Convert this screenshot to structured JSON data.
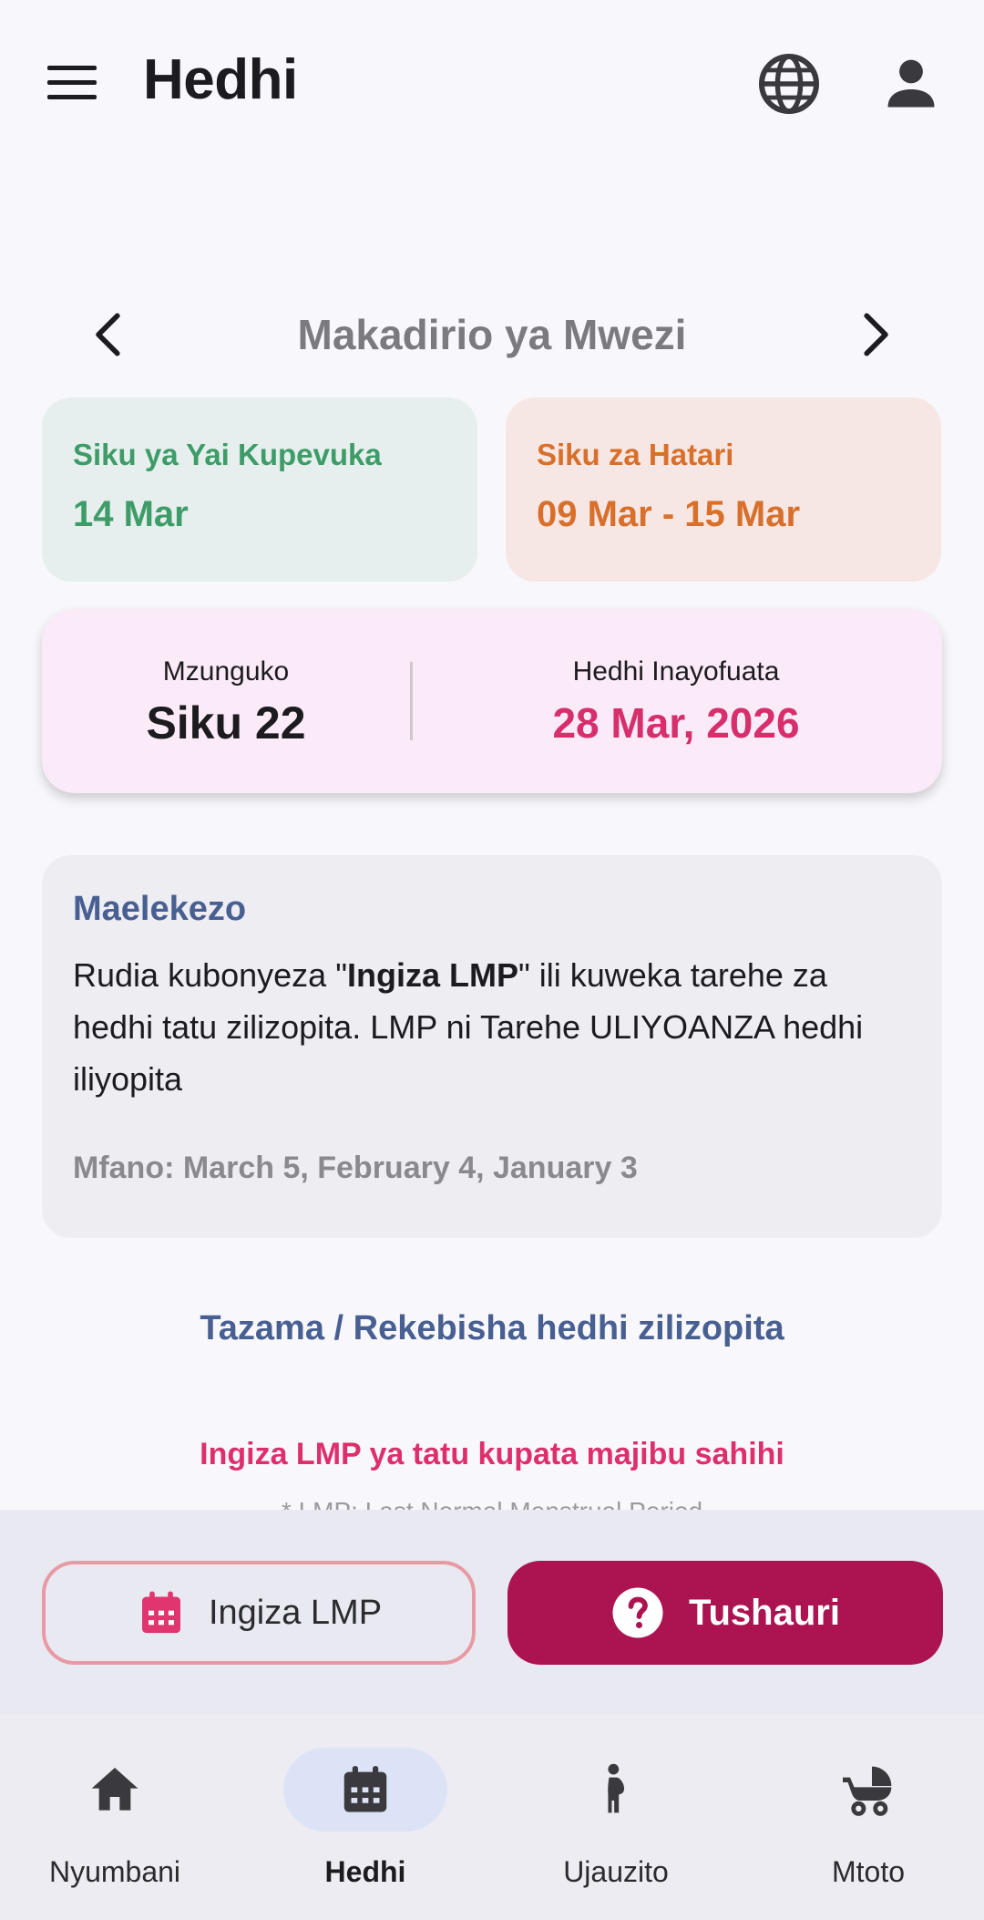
{
  "app": {
    "title": "Hedhi"
  },
  "month": {
    "title": "Makadirio ya Mwezi"
  },
  "ovulation": {
    "label": "Siku ya Yai Kupevuka",
    "value": "14 Mar"
  },
  "danger_days": {
    "label": "Siku za Hatari",
    "value": "09 Mar - 15 Mar"
  },
  "cycle": {
    "length_label": "Mzunguko",
    "length_value": "Siku 22",
    "next_label": "Hedhi Inayofuata",
    "next_value": "28 Mar, 2026"
  },
  "instructions": {
    "title": "Maelekezo",
    "body_prefix": "Rudia kubonyeza \"",
    "body_bold": "Ingiza LMP",
    "body_suffix": "\" ili kuweka tarehe za hedhi tatu zilizopita. LMP ni Tarehe ULIYOANZA hedhi iliyopita",
    "example": "Mfano: March 5, February 4, January 3"
  },
  "links": {
    "past_periods": "Tazama / Rekebisha hedhi zilizopita",
    "warning": "Ingiza LMP ya tatu kupata majibu sahihi",
    "footnote": "* LMP: Last Normal Menstrual Period"
  },
  "actions": {
    "enter_lmp": "Ingiza LMP",
    "advice": "Tushauri"
  },
  "bottom_nav": [
    {
      "label": "Nyumbani",
      "icon": "home-icon",
      "active": false
    },
    {
      "label": "Hedhi",
      "icon": "calendar-icon",
      "active": true
    },
    {
      "label": "Ujauzito",
      "icon": "pregnancy-icon",
      "active": false
    },
    {
      "label": "Mtoto",
      "icon": "stroller-icon",
      "active": false
    }
  ],
  "colors": {
    "primary": "#ab1451",
    "accent_pink": "#d62f6c",
    "accent_blue": "#485f92",
    "green": "#3d9c67",
    "orange": "#d8702b"
  }
}
